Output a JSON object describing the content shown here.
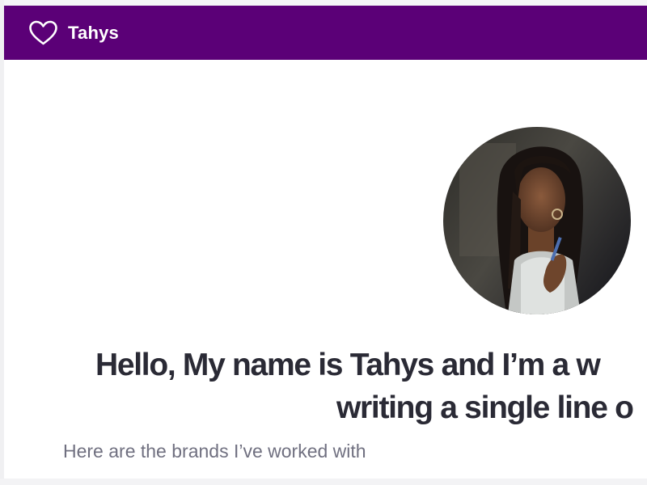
{
  "header": {
    "brand_icon": "heart-icon",
    "brand_name": "Tahys",
    "background_color": "#5b0077"
  },
  "hero": {
    "avatar_alt": "portrait-photo",
    "title_line_1": "Hello, My name is Tahys and I’m a w",
    "title_line_2": "writing a single line o",
    "text_color": "#2a2a35"
  },
  "brands": {
    "heading": "Here are the brands I’ve worked with",
    "text_color": "#707080"
  }
}
